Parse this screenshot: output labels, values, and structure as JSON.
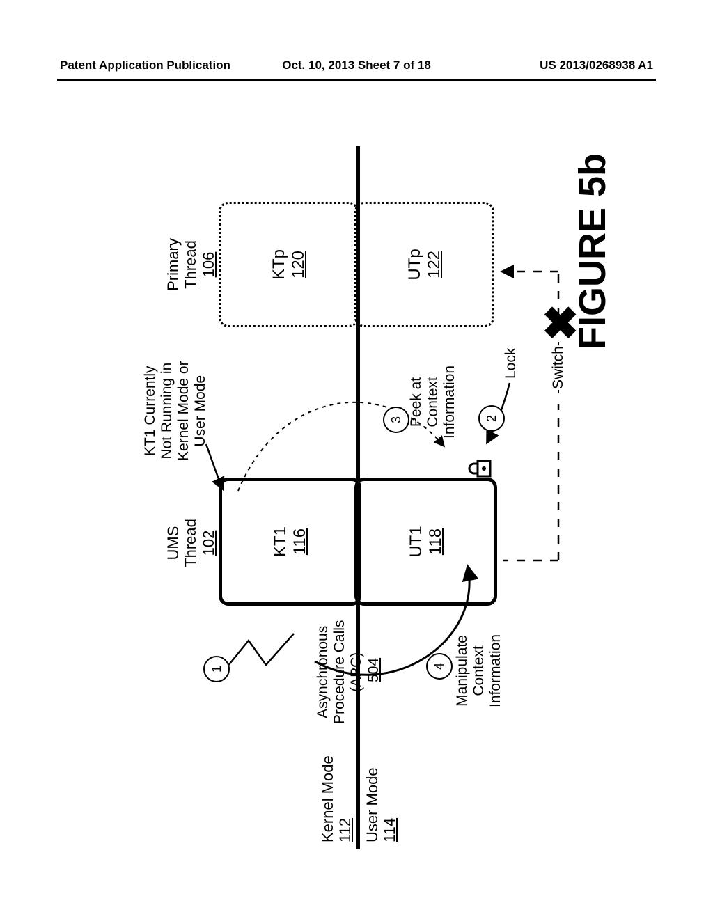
{
  "header": {
    "left": "Patent Application Publication",
    "center": "Oct. 10, 2013  Sheet 7 of 18",
    "right": "US 2013/0268938 A1"
  },
  "figure_label": "FIGURE 5b",
  "modes": {
    "kernel": {
      "name": "Kernel Mode",
      "ref": "112"
    },
    "user": {
      "name": "User Mode",
      "ref": "114"
    }
  },
  "threads": {
    "ums": {
      "title": "UMS\nThread",
      "title_ref": "102",
      "kernel_half": {
        "name": "KT1",
        "ref": "116"
      },
      "user_half": {
        "name": "UT1",
        "ref": "118"
      }
    },
    "primary": {
      "title": "Primary\nThread",
      "title_ref": "106",
      "kernel_half": {
        "name": "KTp",
        "ref": "120"
      },
      "user_half": {
        "name": "UTp",
        "ref": "122"
      }
    }
  },
  "annotations": {
    "not_running": "KT1 Currently\nNot Running in\nKernel Mode or\nUser Mode",
    "apc": {
      "text": "Asynchronous\nProcedure Calls\n(APC)",
      "ref": "504"
    },
    "manipulate": "Manipulate\nContext\nInformation",
    "peek": "Peek at\nContext\nInformation",
    "lock": "Lock",
    "switch": "Switch"
  },
  "steps": {
    "one": "1",
    "two": "2",
    "three": "3",
    "four": "4"
  },
  "glyphs": {
    "x": "✖"
  }
}
